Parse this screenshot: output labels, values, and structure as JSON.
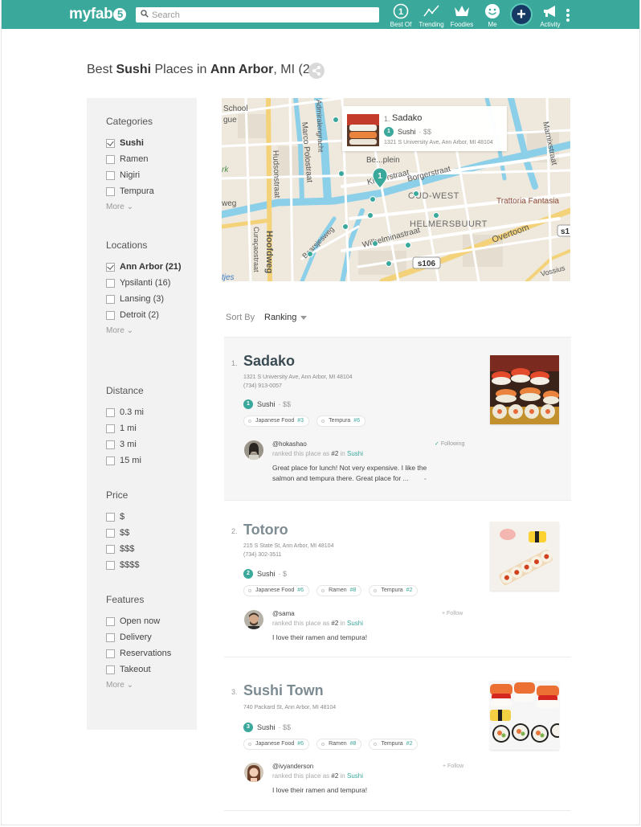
{
  "header": {
    "logo": "myfab",
    "logo_five": "5",
    "search_placeholder": "Search",
    "nav": [
      {
        "label": "Best Of",
        "icon": "best-of-icon"
      },
      {
        "label": "Trending",
        "icon": "trending-icon"
      },
      {
        "label": "Foodies",
        "icon": "crown-icon"
      },
      {
        "label": "Me",
        "icon": "smiley-icon"
      },
      {
        "label": "",
        "icon": "plus-icon"
      },
      {
        "label": "Activity",
        "icon": "megaphone-icon"
      }
    ],
    "plus": "+",
    "accent": "#3aa89a"
  },
  "title": {
    "prefix": "Best",
    "category": "Sushi",
    "middle": "Places in",
    "city": "Ann Arbor",
    "suffix": ", MI (21)"
  },
  "sidebar": {
    "categories": {
      "heading": "Categories",
      "items": [
        {
          "label": "Sushi",
          "checked": true
        },
        {
          "label": "Ramen",
          "checked": false
        },
        {
          "label": "Nigiri",
          "checked": false
        },
        {
          "label": "Tempura",
          "checked": false
        }
      ],
      "more": "More"
    },
    "locations": {
      "heading": "Locations",
      "items": [
        {
          "label": "Ann Arbor (21)",
          "checked": true
        },
        {
          "label": "Ypsilanti (16)",
          "checked": false
        },
        {
          "label": "Lansing (3)",
          "checked": false
        },
        {
          "label": "Detroit (2)",
          "checked": false
        }
      ],
      "more": "More"
    },
    "distance": {
      "heading": "Distance",
      "items": [
        {
          "label": "0.3 mi"
        },
        {
          "label": "1 mi"
        },
        {
          "label": "3 mi"
        },
        {
          "label": "15 mi"
        }
      ]
    },
    "price": {
      "heading": "Price",
      "items": [
        {
          "label": "$"
        },
        {
          "label": "$$"
        },
        {
          "label": "$$$"
        },
        {
          "label": "$$$$"
        }
      ]
    },
    "features": {
      "heading": "Features",
      "items": [
        {
          "label": "Open now"
        },
        {
          "label": "Delivery"
        },
        {
          "label": "Reservations"
        },
        {
          "label": "Takeout"
        }
      ],
      "more": "More"
    }
  },
  "map": {
    "labels": {
      "school": "School",
      "gue": "gue",
      "rk": "rk",
      "weg": "weg",
      "tjes": "tjes",
      "admiralen": "Admiralengracht",
      "marco": "Marco Polostraat",
      "hudson": "Hudsonstraat",
      "curacao": "Curaçaostraat",
      "hoofdweg": "Hoofdweg",
      "baarsjesweg": "Baarsjesweg",
      "bellamy": "Be...plein",
      "kinker": "Kinkerstraat",
      "borger": "Borgerstraat",
      "oudwest": "OUD-WEST",
      "helmers": "HELMERSBUURT",
      "trattoria": "Trattoria Fantasia",
      "overtoom": "Overtoom",
      "wilhelmina": "Wilhelminastraat",
      "marnix": "Marnixstraat",
      "vossius": "Vossius",
      "s106": "s106",
      "s1": "s1",
      "pin_number": "1"
    },
    "card": {
      "rank": "1.",
      "name": "Sadako",
      "category_rank": "1",
      "category": "Sushi",
      "price": "· $$",
      "address": "1321 S University Ave, Ann Arbor, MI 48104"
    }
  },
  "sort": {
    "label": "Sort By",
    "value": "Ranking"
  },
  "listings": [
    {
      "rank": "1.",
      "name": "Sadako",
      "address": "1321 S University Ave, Ann Arbor, MI 48104",
      "phone": "(734) 913-0057",
      "category_rank": "1",
      "category": "Sushi",
      "price": "· $$",
      "tags": [
        {
          "label": "Japanese Food",
          "rank": "#3"
        },
        {
          "label": "Tempura",
          "rank": "#6"
        }
      ],
      "review": {
        "user": "@hokashao",
        "meta_prefix": "ranked this place as",
        "meta_rank": "#2",
        "meta_in": "in",
        "meta_place": "Sushi",
        "text": "Great place for lunch! Not very expensive. I like the salmon and tempura there. Great place for ...",
        "follow": "Following",
        "following": true
      }
    },
    {
      "rank": "2.",
      "name": "Totoro",
      "address": "215 S State St, Ann Arbor, MI 48104",
      "phone": "(734) 302-3511",
      "category_rank": "2",
      "category": "Sushi",
      "price": "· $",
      "tags": [
        {
          "label": "Japanese Food",
          "rank": "#6"
        },
        {
          "label": "Ramen",
          "rank": "#8"
        },
        {
          "label": "Tempura",
          "rank": "#2"
        }
      ],
      "review": {
        "user": "@sama",
        "meta_prefix": "ranked this place as",
        "meta_rank": "#2",
        "meta_in": "in",
        "meta_place": "Sushi",
        "text": "I love their ramen and tempura!",
        "follow": "+ Follow",
        "following": false
      }
    },
    {
      "rank": "3.",
      "name": "Sushi Town",
      "address": "740 Packard St, Ann Arbor, MI 48104",
      "phone": "",
      "category_rank": "3",
      "category": "Sushi",
      "price": "· $$",
      "tags": [
        {
          "label": "Japanese Food",
          "rank": "#6"
        },
        {
          "label": "Ramen",
          "rank": "#8"
        },
        {
          "label": "Tempura",
          "rank": "#2"
        }
      ],
      "review": {
        "user": "@ivyanderson",
        "meta_prefix": "ranked this place as",
        "meta_rank": "#2",
        "meta_in": "in",
        "meta_place": "Sushi",
        "text": "I love their ramen and tempura!",
        "follow": "+ Follow",
        "following": false
      }
    }
  ]
}
